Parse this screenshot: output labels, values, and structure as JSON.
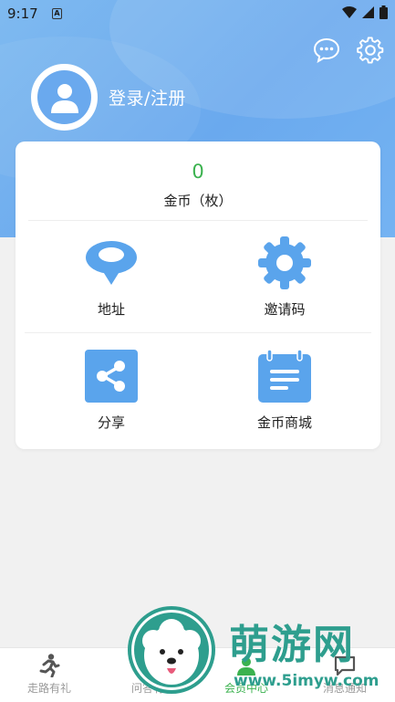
{
  "status_bar": {
    "time": "9:17",
    "notification_badge": "A"
  },
  "header": {
    "message_icon": "chat-bubble-icon",
    "settings_icon": "gear-icon",
    "login_label": "登录/注册"
  },
  "coins": {
    "value": "0",
    "label": "金币（枚）"
  },
  "grid": {
    "items": [
      {
        "label": "地址",
        "icon": "location-pin-icon"
      },
      {
        "label": "邀请码",
        "icon": "gear-icon"
      },
      {
        "label": "分享",
        "icon": "share-icon"
      },
      {
        "label": "金币商城",
        "icon": "calendar-list-icon"
      }
    ]
  },
  "tabbar": {
    "tabs": [
      {
        "label": "走路有礼",
        "icon": "running-person-icon",
        "active": false
      },
      {
        "label": "问答有",
        "icon": "question-icon",
        "active": false
      },
      {
        "label": "会员中心",
        "icon": "member-icon",
        "active": true
      },
      {
        "label": "消息通知",
        "icon": "message-icon",
        "active": false
      }
    ]
  },
  "watermark": {
    "brand": "萌游网",
    "url": "www.5imyw.com"
  },
  "colors": {
    "primary_blue": "#6aa9ee",
    "accent_green": "#3bb24f",
    "background": "#f1f1f1",
    "watermark_teal": "#2e9e8e"
  }
}
